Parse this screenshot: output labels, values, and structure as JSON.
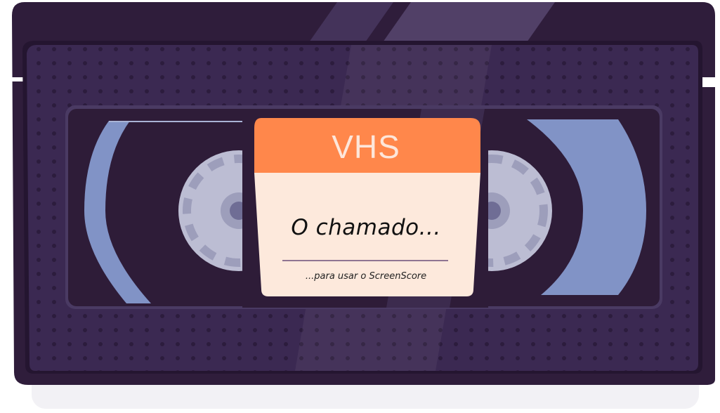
{
  "label": {
    "title": "VHS",
    "main_text": "O chamado...",
    "subtitle": "...para usar o ScreenScore"
  },
  "colors": {
    "shell": "#2f1d3b",
    "panel": "#3b2952",
    "window": "#2e1c38",
    "tape": "#8193c6",
    "reel": "#bcbdd3",
    "label_header": "#ff874b",
    "label_body": "#fde9dc"
  }
}
